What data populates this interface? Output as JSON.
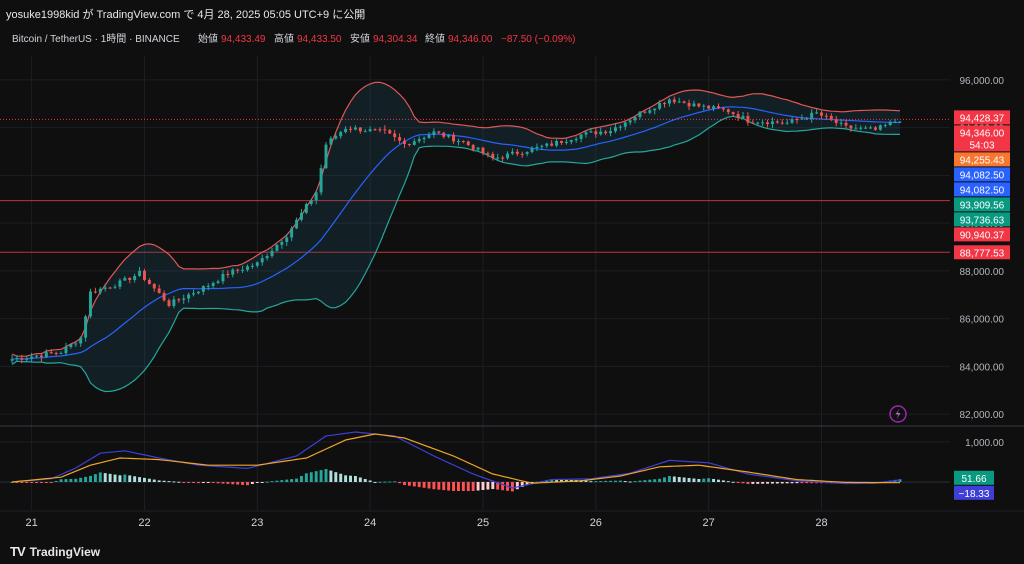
{
  "header": {
    "published_text": "yosuke1998kid が TradingView.com で 4月 28, 2025 05:05 UTC+9 に公開"
  },
  "legend": {
    "symbol": "Bitcoin / TetherUS · 1時間 · BINANCE",
    "open_label": "始値",
    "open_value": "94,433.49",
    "high_label": "高値",
    "high_value": "94,433.50",
    "low_label": "安値",
    "low_value": "94,304.34",
    "close_label": "終値",
    "close_value": "94,346.00",
    "change": "−87.50 (−0.09%)"
  },
  "footer": {
    "brand": "TradingView",
    "logo": "TV"
  },
  "colors": {
    "up": "#26a69a",
    "down": "#ef5350",
    "bb_upper": "#e05757",
    "bb_lower": "#26a69a",
    "bb_basis": "#2962ff",
    "macd": "#3f3fd8",
    "signal": "#f0a524",
    "label_red": "#f23645",
    "label_orange": "#f7772f",
    "label_blue": "#2962ff",
    "label_teal": "#089981"
  },
  "chart_data": [
    {
      "type": "candlestick",
      "timeframe": "1h",
      "ylim": [
        81500,
        97000
      ],
      "y_ticks": [
        "96,000.00",
        "94,000.00",
        "92,000.00",
        "90,000.00",
        "88,000.00",
        "86,000.00",
        "84,000.00",
        "82,000.00"
      ],
      "x_ticks": [
        "21",
        "22",
        "23",
        "24",
        "25",
        "26",
        "27",
        "28"
      ],
      "close_path": [
        {
          "t": 0,
          "v": 84300
        },
        {
          "t": 10,
          "v": 84600
        },
        {
          "t": 14,
          "v": 85200
        },
        {
          "t": 16,
          "v": 87100
        },
        {
          "t": 22,
          "v": 87500
        },
        {
          "t": 26,
          "v": 87900
        },
        {
          "t": 32,
          "v": 86600
        },
        {
          "t": 40,
          "v": 87400
        },
        {
          "t": 44,
          "v": 87900
        },
        {
          "t": 50,
          "v": 88300
        },
        {
          "t": 56,
          "v": 89500
        },
        {
          "t": 62,
          "v": 91300
        },
        {
          "t": 64,
          "v": 93300
        },
        {
          "t": 68,
          "v": 94000
        },
        {
          "t": 72,
          "v": 93900
        },
        {
          "t": 76,
          "v": 93800
        },
        {
          "t": 80,
          "v": 93300
        },
        {
          "t": 86,
          "v": 93800
        },
        {
          "t": 92,
          "v": 93400
        },
        {
          "t": 98,
          "v": 92700
        },
        {
          "t": 102,
          "v": 92900
        },
        {
          "t": 110,
          "v": 93300
        },
        {
          "t": 116,
          "v": 93700
        },
        {
          "t": 122,
          "v": 93900
        },
        {
          "t": 128,
          "v": 94600
        },
        {
          "t": 134,
          "v": 95200
        },
        {
          "t": 140,
          "v": 94900
        },
        {
          "t": 146,
          "v": 94700
        },
        {
          "t": 150,
          "v": 94300
        },
        {
          "t": 158,
          "v": 94200
        },
        {
          "t": 164,
          "v": 94600
        },
        {
          "t": 170,
          "v": 94000
        },
        {
          "t": 176,
          "v": 93900
        },
        {
          "t": 181,
          "v": 94346
        }
      ],
      "price_labels": [
        {
          "value": 94428.37,
          "text": "94,428.37",
          "role": "bb_upper",
          "color": "#f23645"
        },
        {
          "value": 94346.0,
          "text": "94,346.00",
          "sub": "54:03",
          "role": "last_price",
          "color": "#f23645"
        },
        {
          "value": 94255.43,
          "text": "94,255.43",
          "role": "level",
          "color": "#f7772f"
        },
        {
          "value": 94082.5,
          "text": "94,082.50",
          "role": "bb_basis",
          "color": "#2962ff"
        },
        {
          "value": 94082.5,
          "text": "94,082.50",
          "role": "bb_basis_2",
          "color": "#2962ff"
        },
        {
          "value": 93909.56,
          "text": "93,909.56",
          "role": "bb_lower",
          "color": "#089981"
        },
        {
          "value": 93736.63,
          "text": "93,736.63",
          "role": "bb_lower_2",
          "color": "#089981"
        },
        {
          "value": 90940.37,
          "text": "90,940.37",
          "role": "horizontal_line",
          "color": "#f23645"
        },
        {
          "value": 88777.53,
          "text": "88,777.53",
          "role": "horizontal_line",
          "color": "#f23645"
        }
      ],
      "horizontal_lines": [
        90940.37,
        88777.53
      ]
    },
    {
      "type": "macd",
      "ylim": [
        -700,
        1350
      ],
      "y_ticks": [
        "1,000.00"
      ],
      "macd_value": "51.66",
      "signal_value": "−18.33",
      "macd_path": [
        {
          "t": 0,
          "v": 0
        },
        {
          "t": 8,
          "v": 80
        },
        {
          "t": 13,
          "v": 350
        },
        {
          "t": 18,
          "v": 720
        },
        {
          "t": 23,
          "v": 780
        },
        {
          "t": 30,
          "v": 600
        },
        {
          "t": 38,
          "v": 420
        },
        {
          "t": 48,
          "v": 340
        },
        {
          "t": 58,
          "v": 650
        },
        {
          "t": 64,
          "v": 1150
        },
        {
          "t": 70,
          "v": 1250
        },
        {
          "t": 78,
          "v": 1150
        },
        {
          "t": 86,
          "v": 650
        },
        {
          "t": 94,
          "v": 200
        },
        {
          "t": 102,
          "v": -150
        },
        {
          "t": 110,
          "v": 60
        },
        {
          "t": 118,
          "v": 80
        },
        {
          "t": 126,
          "v": 220
        },
        {
          "t": 134,
          "v": 540
        },
        {
          "t": 142,
          "v": 480
        },
        {
          "t": 150,
          "v": 200
        },
        {
          "t": 160,
          "v": 30
        },
        {
          "t": 170,
          "v": -40
        },
        {
          "t": 176,
          "v": -30
        },
        {
          "t": 181,
          "v": 51.66
        }
      ],
      "signal_path": [
        {
          "t": 0,
          "v": 0
        },
        {
          "t": 10,
          "v": 120
        },
        {
          "t": 16,
          "v": 420
        },
        {
          "t": 22,
          "v": 600
        },
        {
          "t": 30,
          "v": 560
        },
        {
          "t": 40,
          "v": 420
        },
        {
          "t": 50,
          "v": 420
        },
        {
          "t": 60,
          "v": 600
        },
        {
          "t": 68,
          "v": 1050
        },
        {
          "t": 74,
          "v": 1200
        },
        {
          "t": 80,
          "v": 1100
        },
        {
          "t": 90,
          "v": 650
        },
        {
          "t": 98,
          "v": 200
        },
        {
          "t": 106,
          "v": -30
        },
        {
          "t": 116,
          "v": 30
        },
        {
          "t": 124,
          "v": 150
        },
        {
          "t": 132,
          "v": 380
        },
        {
          "t": 140,
          "v": 420
        },
        {
          "t": 150,
          "v": 250
        },
        {
          "t": 160,
          "v": 60
        },
        {
          "t": 170,
          "v": -10
        },
        {
          "t": 181,
          "v": -18.33
        }
      ]
    }
  ]
}
